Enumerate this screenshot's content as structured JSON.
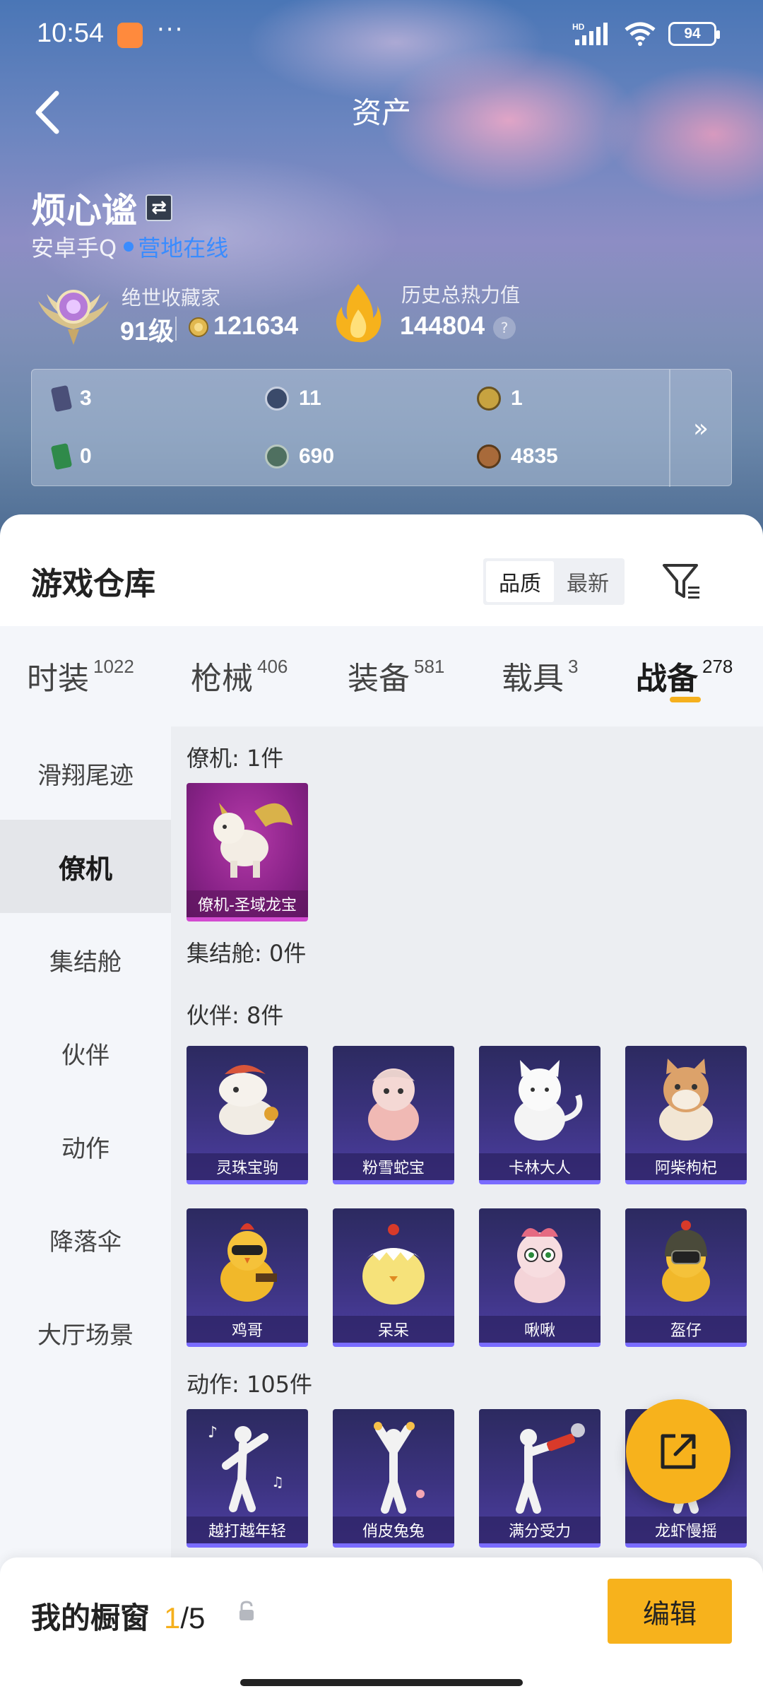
{
  "status_bar": {
    "time": "10:54",
    "dots": "···",
    "net": "HD",
    "battery": "94"
  },
  "header": {
    "title": "资产",
    "back_icon": "chevron-left-icon"
  },
  "profile": {
    "name": "烦心谧",
    "account": "安卓手Q",
    "online_status": "营地在线",
    "rank_title": "绝世收藏家",
    "level": "91级",
    "coins": "121634",
    "heat_title": "历史总热力值",
    "heat_value": "144804",
    "help": "?"
  },
  "currencies": [
    {
      "value": "3",
      "color": "#4a4f78"
    },
    {
      "value": "11",
      "color": "#3a4a6a"
    },
    {
      "value": "1",
      "color": "#c7a340"
    },
    {
      "value": "0",
      "color": "#2f8a4a"
    },
    {
      "value": "690",
      "color": "#4f7060"
    },
    {
      "value": "4835",
      "color": "#a86a3a"
    }
  ],
  "currency_more": "»",
  "warehouse": {
    "title": "游戏仓库",
    "sort_options": [
      "品质",
      "最新"
    ],
    "sort_active": "品质"
  },
  "tabs": [
    {
      "label": "时装",
      "count": "1022"
    },
    {
      "label": "枪械",
      "count": "406"
    },
    {
      "label": "装备",
      "count": "581"
    },
    {
      "label": "载具",
      "count": "3"
    },
    {
      "label": "战备",
      "count": "278"
    }
  ],
  "active_tab": "战备",
  "side_nav": [
    "滑翔尾迹",
    "僚机",
    "集结舱",
    "伙伴",
    "动作",
    "降落伞",
    "大厅场景"
  ],
  "side_active": "僚机",
  "sections": {
    "wingman": {
      "title": "僚机: 1件",
      "items": [
        "僚机-圣域龙宝"
      ]
    },
    "capsule": {
      "title": "集结舱: 0件"
    },
    "partner": {
      "title": "伙伴: 8件",
      "items": [
        "灵珠宝驹",
        "粉雪蛇宝",
        "卡林大人",
        "阿柴枸杞",
        "鸡哥",
        "呆呆",
        "啾啾",
        "盔仔"
      ]
    },
    "action": {
      "title": "动作: 105件",
      "items": [
        "越打越年轻",
        "俏皮兔兔",
        "满分受力",
        "龙虾慢摇"
      ]
    }
  },
  "showcase": {
    "label": "我的橱窗",
    "current": "1",
    "total": "/5",
    "edit": "编辑"
  },
  "colors": {
    "accent": "#f7b21c",
    "online": "#3a8cff",
    "purple_rarity": "#d24bd0",
    "blue_rarity": "#7a6cff"
  }
}
